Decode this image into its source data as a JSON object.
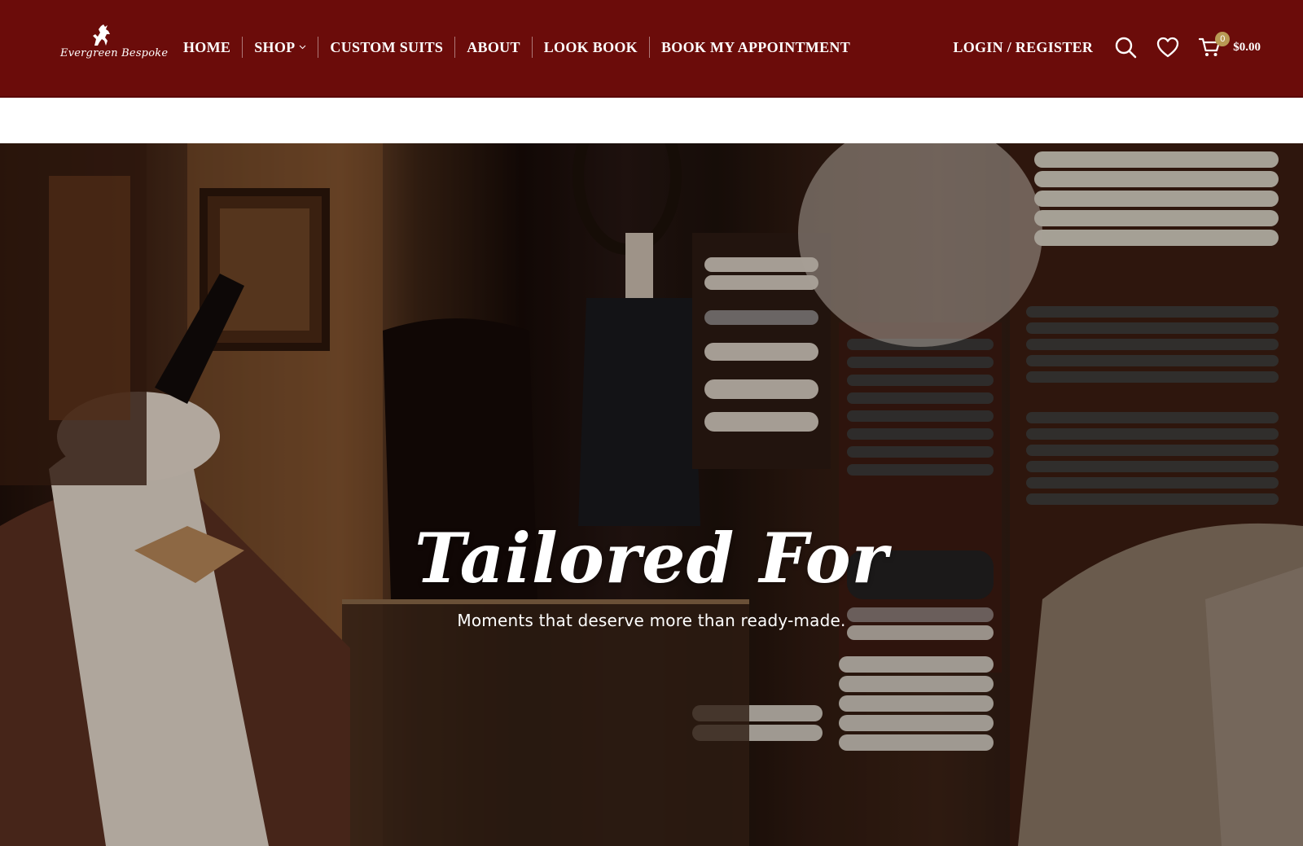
{
  "brand": {
    "name": "Evergreen Bespoke",
    "header_color": "#6b0c0a",
    "badge_color": "#b89a54"
  },
  "nav": {
    "items": [
      {
        "label": "HOME"
      },
      {
        "label": "SHOP",
        "has_dropdown": true
      },
      {
        "label": "CUSTOM SUITS"
      },
      {
        "label": "ABOUT"
      },
      {
        "label": "LOOK BOOK"
      },
      {
        "label": "BOOK MY APPOINTMENT"
      }
    ]
  },
  "header_actions": {
    "login_label": "LOGIN / REGISTER",
    "search_icon": "search-icon",
    "wishlist_icon": "heart-icon",
    "cart_icon": "cart-icon",
    "cart_count": "0",
    "cart_total": "$0.00"
  },
  "hero": {
    "title": "Tailored For",
    "subtitle": "Moments that deserve more than ready-made."
  }
}
